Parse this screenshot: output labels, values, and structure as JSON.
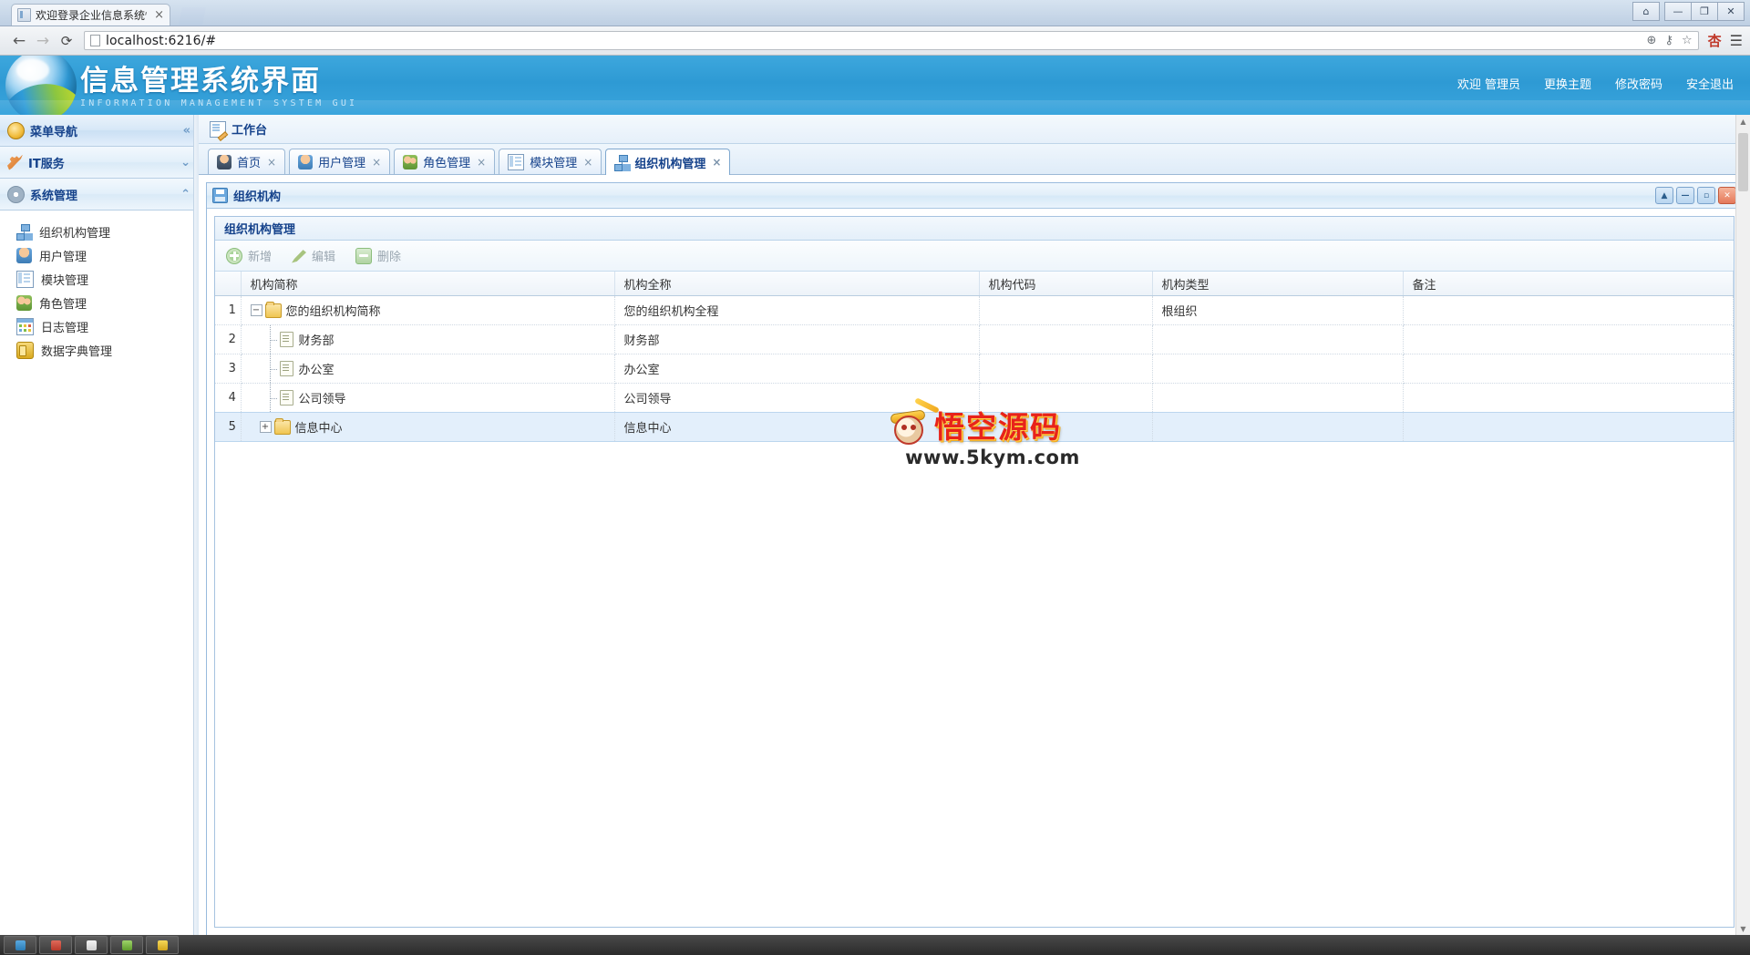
{
  "browser": {
    "tab_title": "欢迎登录企业信息系统快",
    "tab_close": "×",
    "url_text": "localhost:6216/#",
    "back_icon": "←",
    "forward_icon": "→",
    "reload_icon": "⟳",
    "omnibox_icons": {
      "zoom": "⊕",
      "key": "⚷",
      "star": "☆"
    },
    "chrome_right": {
      "profile_cn": "杏",
      "menu": "☰"
    },
    "window_controls": {
      "user": "⌂",
      "minimize": "—",
      "restore": "❐",
      "close": "✕"
    }
  },
  "header": {
    "title": "信息管理系统界面",
    "subtitle": "INFORMATION MANAGEMENT SYSTEM GUI",
    "nav": [
      {
        "label": "欢迎 管理员",
        "name": "welcome-admin-link"
      },
      {
        "label": "更换主题",
        "name": "change-theme-link"
      },
      {
        "label": "修改密码",
        "name": "change-password-link"
      },
      {
        "label": "安全退出",
        "name": "logout-link"
      }
    ]
  },
  "sidebar": {
    "groups": [
      {
        "label": "菜单导航",
        "icon": "medal-icon",
        "arrow": "«",
        "expanded": false
      },
      {
        "label": "IT服务",
        "icon": "wrench-icon",
        "arrow": "⌄",
        "expanded": false
      },
      {
        "label": "系统管理",
        "icon": "gear-icon",
        "arrow": "⌃",
        "expanded": true
      }
    ],
    "items": [
      {
        "label": "组织机构管理",
        "icon": "org-chart-icon"
      },
      {
        "label": "用户管理",
        "icon": "user-icon"
      },
      {
        "label": "模块管理",
        "icon": "module-icon"
      },
      {
        "label": "角色管理",
        "icon": "role-icon"
      },
      {
        "label": "日志管理",
        "icon": "log-icon"
      },
      {
        "label": "数据字典管理",
        "icon": "dictionary-icon"
      }
    ]
  },
  "workbench": {
    "label": "工作台",
    "icon": "workbench-icon"
  },
  "tabs": [
    {
      "label": "首页",
      "icon": "home-user-icon",
      "active": false,
      "close": "×"
    },
    {
      "label": "用户管理",
      "icon": "user-icon",
      "active": false,
      "close": "×"
    },
    {
      "label": "角色管理",
      "icon": "role-icon",
      "active": false,
      "close": "×"
    },
    {
      "label": "模块管理",
      "icon": "module-icon",
      "active": false,
      "close": "×"
    },
    {
      "label": "组织机构管理",
      "icon": "org-chart-icon",
      "active": true,
      "close": "×"
    }
  ],
  "panel": {
    "title": "组织机构",
    "icon": "save-icon",
    "tools": [
      {
        "name": "collapse-button",
        "glyph": "▲"
      },
      {
        "name": "minimize-button",
        "glyph": "—"
      },
      {
        "name": "maximize-button",
        "glyph": "▫"
      },
      {
        "name": "close-button",
        "glyph": "✕"
      }
    ]
  },
  "grid": {
    "title": "组织机构管理",
    "toolbar": [
      {
        "label": "新增",
        "icon": "add-icon",
        "name": "add-button"
      },
      {
        "label": "编辑",
        "icon": "edit-pencil-icon",
        "name": "edit-button"
      },
      {
        "label": "删除",
        "icon": "delete-icon",
        "name": "delete-button"
      }
    ],
    "columns": [
      {
        "key": "rownum",
        "label": ""
      },
      {
        "key": "short_name",
        "label": "机构简称"
      },
      {
        "key": "full_name",
        "label": "机构全称"
      },
      {
        "key": "code",
        "label": "机构代码"
      },
      {
        "key": "type",
        "label": "机构类型"
      },
      {
        "key": "remark",
        "label": "备注"
      }
    ],
    "rows": [
      {
        "num": "1",
        "short_name": "您的组织机构简称",
        "full_name": "您的组织机构全程",
        "code": "",
        "type": "根组织",
        "remark": "",
        "level": 0,
        "node": "folder",
        "toggle": "−",
        "selected": false
      },
      {
        "num": "2",
        "short_name": "财务部",
        "full_name": "财务部",
        "code": "",
        "type": "",
        "remark": "",
        "level": 1,
        "node": "file",
        "toggle": "",
        "selected": false
      },
      {
        "num": "3",
        "short_name": "办公室",
        "full_name": "办公室",
        "code": "",
        "type": "",
        "remark": "",
        "level": 1,
        "node": "file",
        "toggle": "",
        "selected": false
      },
      {
        "num": "4",
        "short_name": "公司领导",
        "full_name": "公司领导",
        "code": "",
        "type": "",
        "remark": "",
        "level": 1,
        "node": "file",
        "toggle": "",
        "selected": false
      },
      {
        "num": "5",
        "short_name": "信息中心",
        "full_name": "信息中心",
        "code": "",
        "type": "",
        "remark": "",
        "level": 1,
        "node": "folder",
        "toggle": "+",
        "selected": true
      }
    ]
  },
  "watermark": {
    "text": "悟空源码",
    "url": "www.5kym.com"
  },
  "colors": {
    "header_blue": "#2e9ad4",
    "panel_border": "#99bbdd",
    "title_text": "#15428b",
    "selected_row": "#e3effb",
    "watermark_red": "#e8231a"
  }
}
